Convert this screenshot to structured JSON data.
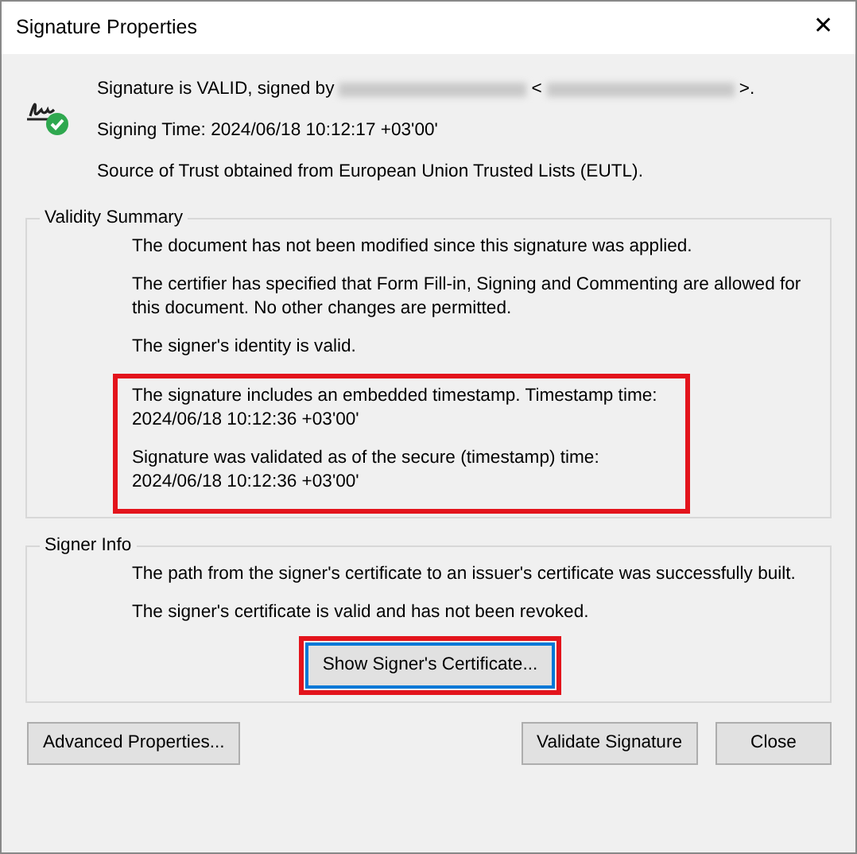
{
  "window": {
    "title": "Signature Properties",
    "close": "✕"
  },
  "status": {
    "valid": true,
    "lines": [
      {
        "kind": "signer",
        "prefix": "Signature is VALID, signed by",
        "open": "<",
        "close": ">."
      },
      {
        "kind": "text",
        "text": "Signing Time:  2024/06/18 10:12:17 +03'00'"
      },
      {
        "kind": "text",
        "text": "Source of Trust obtained from European Union Trusted Lists (EUTL)."
      }
    ]
  },
  "validity_summary": {
    "title": "Validity Summary",
    "items": [
      {
        "text": "The document has not been modified since this signature was applied.",
        "highlighted": false
      },
      {
        "text": "The certifier has specified that Form Fill-in, Signing and Commenting are allowed for this document. No other changes are permitted.",
        "highlighted": false
      },
      {
        "text": "The signer's identity is valid.",
        "highlighted": false
      },
      {
        "text": "The signature includes an embedded timestamp. Timestamp time: 2024/06/18 10:12:36 +03'00'",
        "highlighted": true
      },
      {
        "text": "Signature was validated as of the secure (timestamp) time: 2024/06/18 10:12:36 +03'00'",
        "highlighted": true
      }
    ]
  },
  "signer_info": {
    "title": "Signer Info",
    "items": [
      {
        "text": "The path from the signer's certificate to an issuer's certificate was successfully built."
      },
      {
        "text": "The signer's certificate is valid and has not been revoked."
      }
    ],
    "button": {
      "label": "Show Signer's Certificate...",
      "focused": true,
      "highlighted": true
    }
  },
  "buttons": [
    {
      "label": "Advanced Properties..."
    },
    {
      "label": "Validate Signature"
    },
    {
      "label": "Close"
    }
  ]
}
